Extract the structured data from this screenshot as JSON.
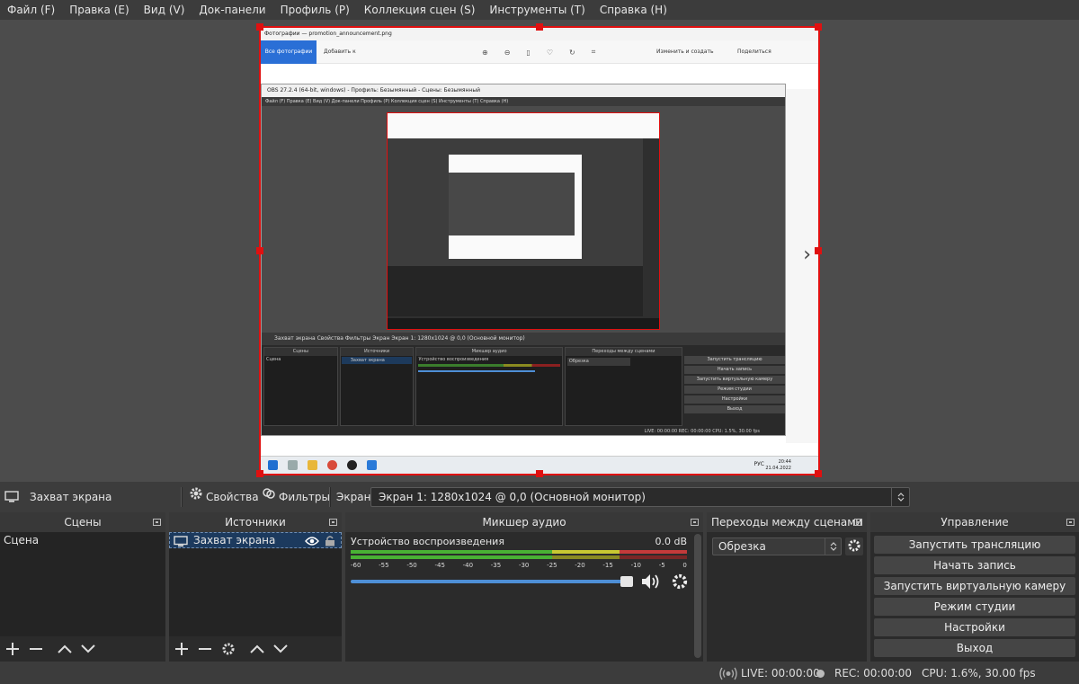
{
  "menu": [
    "Файл (F)",
    "Правка (E)",
    "Вид (V)",
    "Док-панели",
    "Профиль (P)",
    "Коллекция сцен (S)",
    "Инструменты (T)",
    "Справка (H)"
  ],
  "preview": {
    "photos_title": "Фотографии — promotion_announcement.png",
    "all_photos": "Все фотографии",
    "add": "Добавить к",
    "edit_create": "Изменить и создать",
    "share": "Поделиться",
    "inner_title": "OBS 27.2.4 (64-bit, windows) - Профиль: Безымянный - Сцены: Безымянный",
    "inner_menu": "Файл (F)   Правка (E)   Вид (V)   Док-панели   Профиль (P)   Коллекция сцен (S)   Инструменты (T)   Справка (H)",
    "inner_source_bar": "Захват экрана        Свойства   Фильтры   Экран   Экран 1: 1280x1024 @ 0,0 (Основной монитор)",
    "inner_docks": [
      "Сцены",
      "Источники",
      "Микшер аудио",
      "Переходы между сценами"
    ],
    "inner_scene": "Сцена",
    "inner_source": "Захват экрана",
    "inner_device": "Устройство воспроизведения",
    "inner_transition": "Обрезка",
    "inner_controls": [
      "Запустить трансляцию",
      "Начать запись",
      "Запустить виртуальную камеру",
      "Режим студии",
      "Настройки",
      "Выход"
    ],
    "inner_status": "LIVE: 00:00:00   REC: 00:00:00   CPU: 1.5%, 30.00 fps",
    "clock_time": "20:44",
    "clock_date": "21.04.2022",
    "lang": "РУС"
  },
  "source_toolbar": {
    "source_name": "Захват экрана",
    "properties": "Свойства",
    "filters": "Фильтры",
    "screen_label": "Экран",
    "screen_value": "Экран 1: 1280x1024 @ 0,0 (Основной монитор)"
  },
  "scenes": {
    "title": "Сцены",
    "items": [
      "Сцена"
    ]
  },
  "sources": {
    "title": "Источники",
    "items": [
      "Захват экрана"
    ]
  },
  "mixer": {
    "title": "Микшер аудио",
    "device": "Устройство воспроизведения",
    "level": "0.0 dB",
    "scale": [
      "-60",
      "-55",
      "-50",
      "-45",
      "-40",
      "-35",
      "-30",
      "-25",
      "-20",
      "-15",
      "-10",
      "-5",
      "0"
    ],
    "volume_fraction": 1.0
  },
  "transitions": {
    "title": "Переходы между сценами",
    "selected": "Обрезка"
  },
  "controls": {
    "title": "Управление",
    "buttons": [
      "Запустить трансляцию",
      "Начать запись",
      "Запустить виртуальную камеру",
      "Режим студии",
      "Настройки",
      "Выход"
    ]
  },
  "status": {
    "live": "LIVE: 00:00:00",
    "rec": "REC: 00:00:00",
    "cpu": "CPU: 1.6%, 30.00 fps"
  },
  "colors": {
    "accent": "#e01010",
    "selection": "#1c3a5e",
    "slider": "#4e8fd6"
  },
  "icons": [
    "monitor-icon",
    "gear-icon",
    "filter-icon",
    "plus-icon",
    "minus-icon",
    "chevron-up-icon",
    "chevron-down-icon",
    "eye-icon",
    "lock-icon",
    "speaker-icon",
    "float-icon",
    "broadcast-icon"
  ]
}
